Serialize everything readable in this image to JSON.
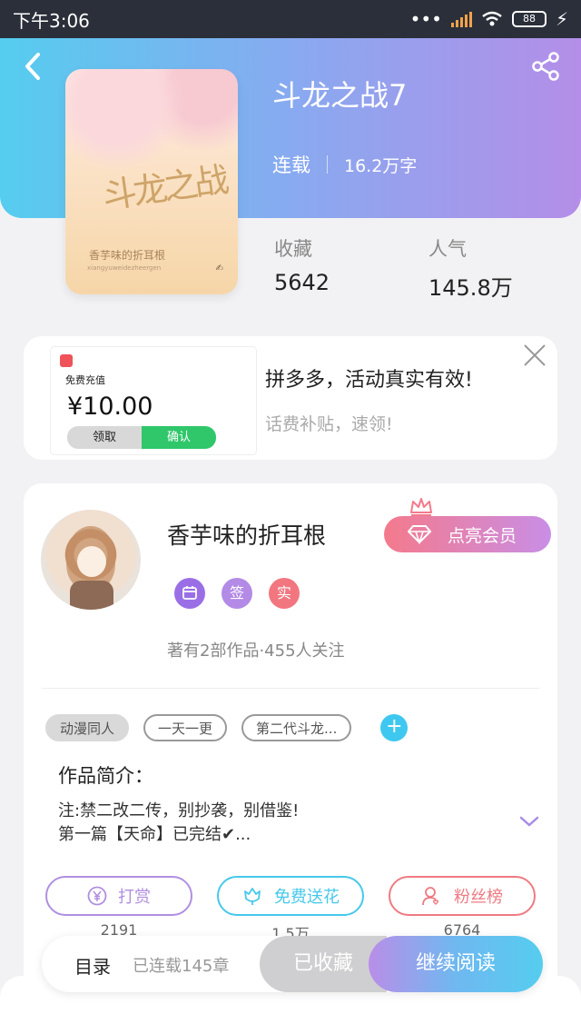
{
  "status_bar": {
    "time": "下午3:06",
    "battery": "88"
  },
  "book": {
    "title": "斗龙之战7",
    "status": "连载",
    "word_count": "16.2万字",
    "cover_title": "斗龙之战",
    "cover_author": "香芋味的折耳根",
    "cover_pinyin": "xiangyuweidezheergen",
    "stats": [
      {
        "label": "收藏",
        "value": "5642"
      },
      {
        "label": "人气",
        "value": "145.8万"
      }
    ]
  },
  "ad": {
    "image_title": "免费充值",
    "image_amount": "¥10.00",
    "image_btn_claim": "领取",
    "image_btn_confirm": "确认",
    "title": "拼多多，活动真实有效!",
    "subtitle": "话费补贴，速领!"
  },
  "author": {
    "name": "香芋味的折耳根",
    "vip_label": "点亮会员",
    "badges": [
      {
        "text": "",
        "color": "#9a6fe6",
        "icon": "calendar-badge-icon"
      },
      {
        "text": "签",
        "color": "#b38ae6"
      },
      {
        "text": "实",
        "color": "#f27680"
      }
    ],
    "follow_text": "著有2部作品·455人关注"
  },
  "tags": [
    "动漫同人",
    "一天一更",
    "第二代斗龙..."
  ],
  "intro": {
    "heading": "作品简介：",
    "line1": "注:禁二改二传，别抄袭，别借鉴!",
    "line2": "第一篇【天命】已完结✔..."
  },
  "actions": [
    {
      "label": "打赏",
      "count": "2191",
      "color": "#b08fe0",
      "icon": "yen-icon"
    },
    {
      "label": "免费送花",
      "count": "1.5万",
      "color": "#47c8ea",
      "icon": "flower-icon"
    },
    {
      "label": "粉丝榜",
      "count": "6764",
      "color": "#ef7a82",
      "icon": "fan-list-icon"
    }
  ],
  "bottom_bar": {
    "toc_label": "目录",
    "toc_sub": "已连载145章",
    "collected_label": "已收藏",
    "continue_label": "继续阅读"
  }
}
